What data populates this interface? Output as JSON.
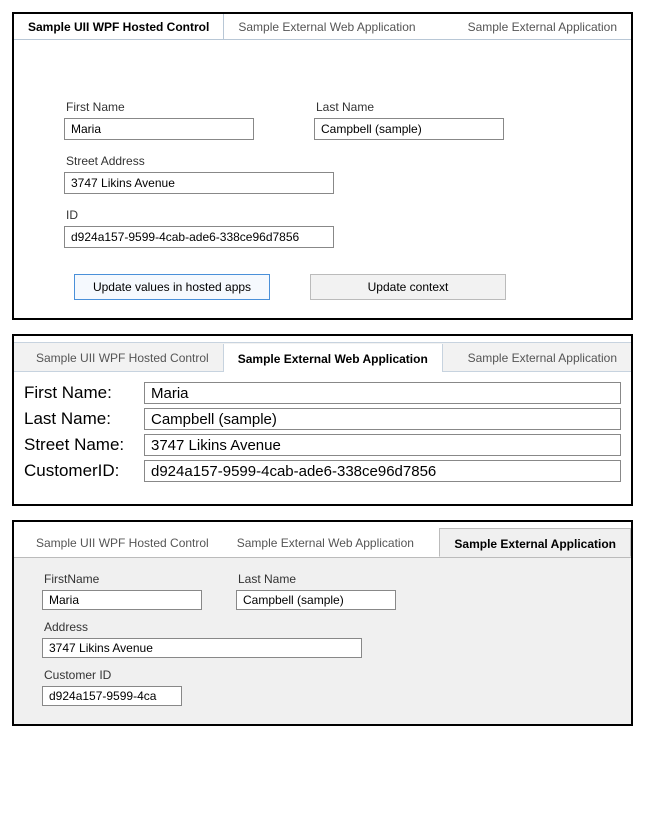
{
  "tabs": {
    "wpf": "Sample UII WPF Hosted Control",
    "web": "Sample External Web Application",
    "ext": "Sample External Application"
  },
  "panel1": {
    "first_name_label": "First Name",
    "first_name": "Maria",
    "last_name_label": "Last Name",
    "last_name": "Campbell (sample)",
    "street_label": "Street Address",
    "street": "3747 Likins Avenue",
    "id_label": "ID",
    "id": "d924a157-9599-4cab-ade6-338ce96d7856",
    "btn_update_apps": "Update values in hosted apps",
    "btn_update_context": "Update context"
  },
  "panel2": {
    "first_name_label": "First Name:",
    "first_name": "Maria",
    "last_name_label": "Last Name:",
    "last_name": "Campbell (sample)",
    "street_label": "Street Name:",
    "street": "3747 Likins Avenue",
    "cust_id_label": "CustomerID:",
    "cust_id": "d924a157-9599-4cab-ade6-338ce96d7856"
  },
  "panel3": {
    "first_name_label": "FirstName",
    "first_name": "Maria",
    "last_name_label": "Last Name",
    "last_name": "Campbell (sample)",
    "address_label": "Address",
    "address": "3747 Likins Avenue",
    "cust_id_label": "Customer ID",
    "cust_id": "d924a157-9599-4ca"
  }
}
